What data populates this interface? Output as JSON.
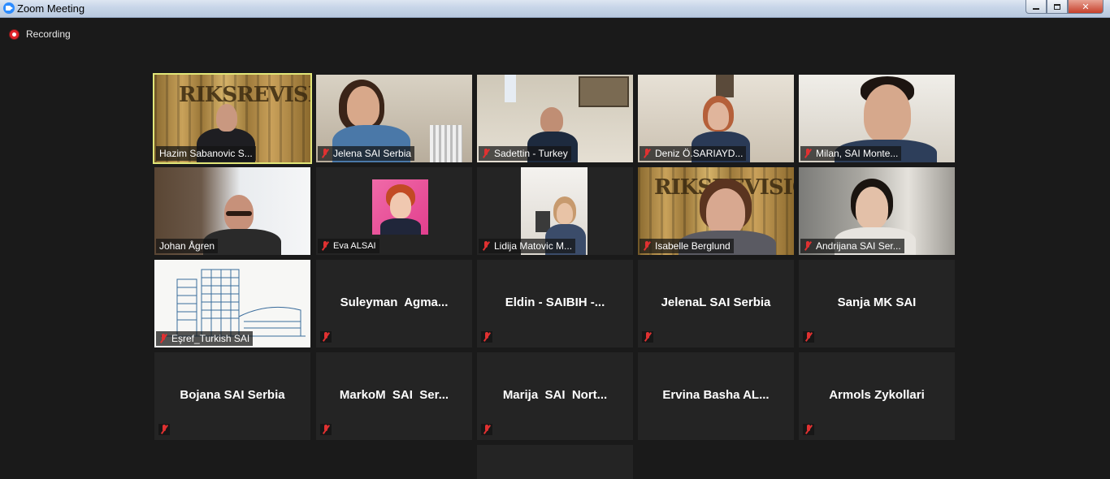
{
  "window": {
    "title": "Zoom Meeting"
  },
  "recording": {
    "label": "Recording"
  },
  "tiles": [
    {
      "name": "Hazim Sabanovic S...",
      "muted": false,
      "video": true
    },
    {
      "name": "Jelena SAI Serbia",
      "muted": true,
      "video": true
    },
    {
      "name": "Sadettin - Turkey",
      "muted": true,
      "video": true
    },
    {
      "name": "Deniz Ö.SARIAYD...",
      "muted": true,
      "video": true
    },
    {
      "name": "Milan, SAI Monte...",
      "muted": true,
      "video": true
    },
    {
      "name": "Johan Ågren",
      "muted": false,
      "video": true
    },
    {
      "name": "Eva ALSAI",
      "muted": true,
      "video": true
    },
    {
      "name": "Lidija Matovic M...",
      "muted": true,
      "video": true
    },
    {
      "name": "Isabelle Berglund",
      "muted": true,
      "video": true
    },
    {
      "name": "Andrijana SAI Ser...",
      "muted": true,
      "video": true
    },
    {
      "name": "Eşref_Turkish SAI",
      "muted": true,
      "video": true
    },
    {
      "name": "Suleyman  Agma...",
      "muted": true,
      "video": false
    },
    {
      "name": "Eldin - SAIBIH -...",
      "muted": true,
      "video": false
    },
    {
      "name": "JelenaL SAI Serbia",
      "muted": true,
      "video": false
    },
    {
      "name": "Sanja MK SAI",
      "muted": true,
      "video": false
    },
    {
      "name": "Bojana SAI Serbia",
      "muted": true,
      "video": false
    },
    {
      "name": "MarkoM  SAI  Ser...",
      "muted": true,
      "video": false
    },
    {
      "name": "Marija  SAI  Nort...",
      "muted": true,
      "video": false
    },
    {
      "name": "Ervina Basha AL...",
      "muted": true,
      "video": false
    },
    {
      "name": "Armols Zykollari",
      "muted": true,
      "video": false
    }
  ],
  "colors": {
    "active_speaker": "#e1e678",
    "background": "#1a1a1a",
    "tile": "#242424",
    "mute": "#e03131"
  }
}
